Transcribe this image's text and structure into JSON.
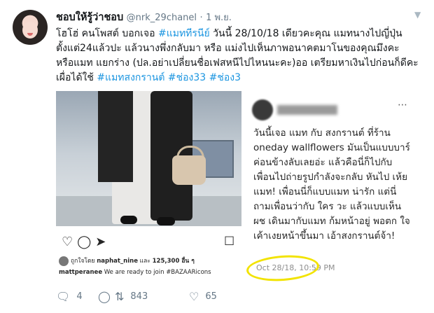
{
  "tweet": {
    "display_name": "ชอบให้รู้ว่าชอบ",
    "handle": "@nrk_29chanel",
    "separator": "·",
    "date": "1 พ.ย.",
    "text_parts": [
      {
        "t": "โฮโฮ่ คนโพสต์ บอกเจอ ",
        "tag": false
      },
      {
        "t": "#แมททีรนีย์",
        "tag": true
      },
      {
        "t": "  วันนี้ 28/10/18 เดียวคะคุณ แมทนางไปญี่ปุ่นตั้งแต่24แล้วปะ แล้วนางพึ่งกลับมา หรือ แม่งไปเห็นภาพอนาคตมาโนของคุณมึงคะ หรือแมท แยกร่าง (ปล.อย่าเปลี่ยนชื่อเฟสหนีไปไหนนะคะ)ออ เตรียมหาเงินไปก่อนก็ดีคะ เผื่อได้ใช้ ",
        "tag": false
      },
      {
        "t": "#แมทสงกรานต์",
        "tag": true
      },
      {
        "t": " ",
        "tag": false
      },
      {
        "t": "#ช่อง33",
        "tag": true
      },
      {
        "t": " ",
        "tag": false
      },
      {
        "t": "#ช่อง3",
        "tag": true
      }
    ]
  },
  "ig_post": {
    "liked_prefix": "ถูกใจโดย",
    "liked_user": "naphat_nine",
    "liked_mid": " และ ",
    "liked_count": "125,300 อื่น ๆ",
    "caption_user": "mattperanee",
    "caption_text": " We are ready to join #BAZAARicons",
    "icons": [
      "heart-icon",
      "comment-icon",
      "share-icon",
      "bookmark-icon"
    ]
  },
  "fb_post": {
    "text": "วันนี้เจอ แมท กับ สงกรานต์ ที่ร้าน oneday wallflowers มันเป็นแบบบาร์ค่อนข้างลับเลยอ่ะ แล้วคือนี่ก็ไปกับเพื่อนไปถ่ายรูปกำลังจะกลับ หันไป เห้ย แมท! เพื่อนนี่ก็แบบแมท น่ารัก แต่นี่ถามเพื่อนว่ากับ ใคร วะ แล้วแบบเห็น ผช เดินมากับแมท ก้มหน้าอยู่ พอตก ใจเค้าเงยหน้าขึ้นมา เอ้าสงกรานต์จ้า!",
    "timestamp": "Oct 28/18, 10:59 PM",
    "highlight_color": "#f2e300"
  },
  "actions": {
    "reply_count": "4",
    "retweet_count": "843",
    "like_count": "65"
  },
  "colors": {
    "link": "#1b95e0",
    "muted": "#657786"
  }
}
